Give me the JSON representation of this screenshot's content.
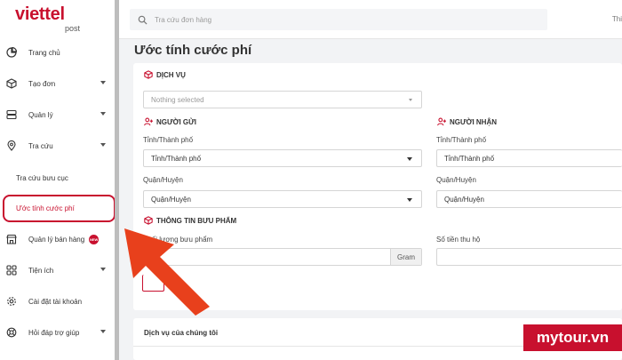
{
  "logo": {
    "brand": "viettel",
    "sub": "post"
  },
  "search": {
    "placeholder": "Tra cứu đơn hàng"
  },
  "topbar": {
    "right_text": "Thi"
  },
  "sidebar": {
    "items": [
      {
        "label": "Trang chủ",
        "icon": "pie-chart-icon"
      },
      {
        "label": "Tạo đơn",
        "icon": "box-icon"
      },
      {
        "label": "Quản lý",
        "icon": "server-icon"
      },
      {
        "label": "Tra cứu",
        "icon": "map-pin-icon"
      },
      {
        "label": "Quản lý bán hàng",
        "icon": "store-icon",
        "badge": "NEW"
      },
      {
        "label": "Tiện ích",
        "icon": "grid-icon"
      },
      {
        "label": "Cài đặt tài khoản",
        "icon": "gear-icon"
      },
      {
        "label": "Hỏi đáp trợ giúp",
        "icon": "lifebuoy-icon"
      }
    ],
    "sub_items": [
      "Tra cứu bưu cục",
      "Ước tính cước phí"
    ]
  },
  "main": {
    "title": "Ước tính cước phí",
    "service": {
      "heading": "DỊCH VỤ",
      "placeholder": "Nothing selected"
    },
    "sender": {
      "heading": "NGƯỜI GỬI",
      "province_label": "Tỉnh/Thành phố",
      "province_value": "Tỉnh/Thành phố",
      "district_label": "Quận/Huyện",
      "district_value": "Quận/Huyện"
    },
    "receiver": {
      "heading": "NGƯỜI NHẬN",
      "province_label": "Tỉnh/Thành phố",
      "province_value": "Tỉnh/Thành phố",
      "district_label": "Quận/Huyện",
      "district_value": "Quận/Huyện"
    },
    "parcel": {
      "heading": "THÔNG TIN BƯU PHẨM",
      "weight_label": "Khối lượng bưu phẩm",
      "weight_unit": "Gram",
      "cod_label": "Số tiền thu hộ"
    },
    "services_section": {
      "heading": "Dịch vụ của chúng tôi"
    }
  },
  "watermark": {
    "text": "mytour.vn"
  },
  "colors": {
    "brand": "#c8102e",
    "arrow": "#e8401c"
  }
}
